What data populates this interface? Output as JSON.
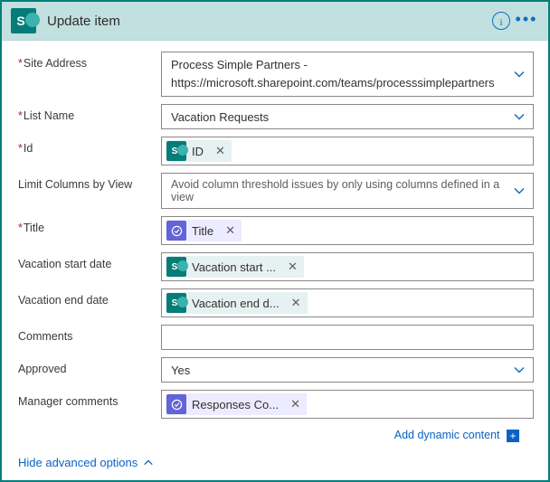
{
  "header": {
    "app_letter": "S",
    "title": "Update item"
  },
  "fields": {
    "site_address": {
      "label": "Site Address",
      "line1": "Process Simple Partners -",
      "line2": "https://microsoft.sharepoint.com/teams/processsimplepartners"
    },
    "list_name": {
      "label": "List Name",
      "value": "Vacation Requests"
    },
    "id": {
      "label": "Id",
      "token": "ID"
    },
    "limit": {
      "label": "Limit Columns by View",
      "placeholder": "Avoid column threshold issues by only using columns defined in a view"
    },
    "title_f": {
      "label": "Title",
      "token": "Title"
    },
    "vstart": {
      "label": "Vacation start date",
      "token": "Vacation start ..."
    },
    "vend": {
      "label": "Vacation end date",
      "token": "Vacation end d..."
    },
    "comments": {
      "label": "Comments"
    },
    "approved": {
      "label": "Approved",
      "value": "Yes"
    },
    "mgr": {
      "label": "Manager comments",
      "token": "Responses Co..."
    }
  },
  "links": {
    "dynamic": "Add dynamic content",
    "advanced": "Hide advanced options"
  },
  "glyphs": {
    "x": "✕",
    "plus": "+"
  }
}
